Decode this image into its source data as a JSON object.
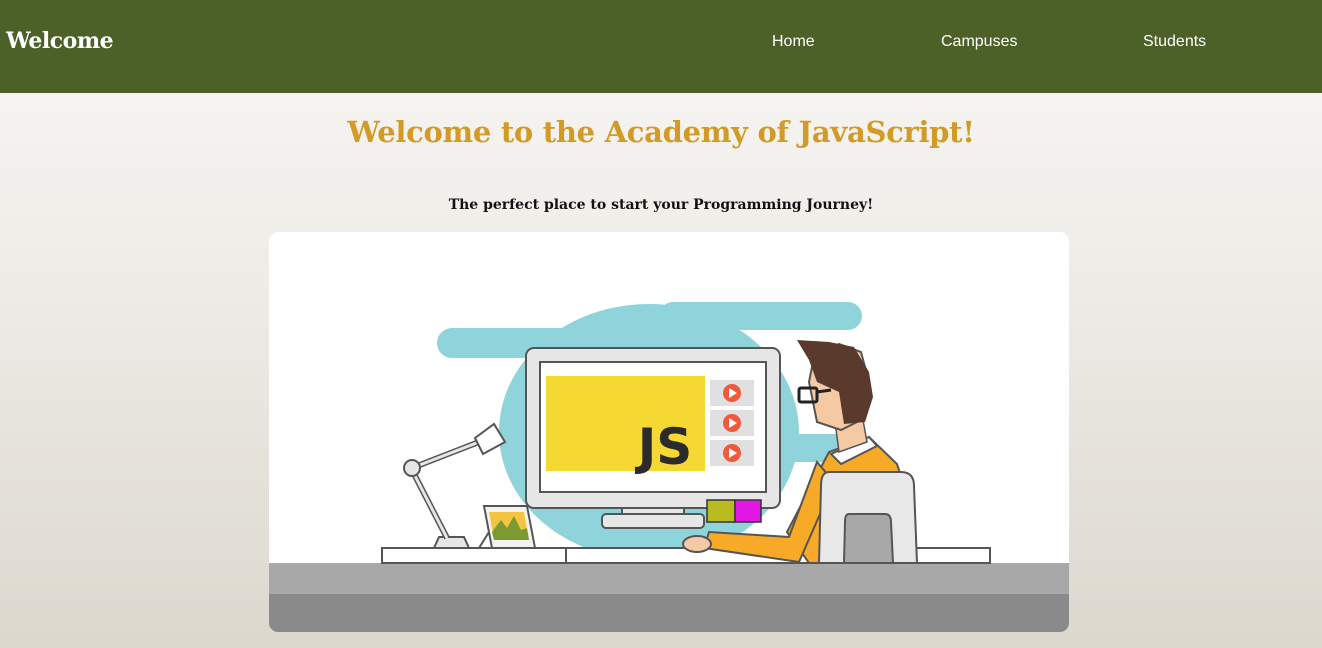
{
  "navbar": {
    "brand": "Welcome",
    "links": [
      {
        "label": "Home"
      },
      {
        "label": "Campuses"
      },
      {
        "label": "Students"
      }
    ],
    "background": "#4b6128"
  },
  "hero": {
    "title": "Welcome to the Academy of JavaScript!",
    "subtitle": "The perfect place to start your Programming Journey!",
    "title_color": "#d29a26",
    "illustration": {
      "screen_label": "JS",
      "description_icon": "developer-at-computer-illustration"
    }
  }
}
